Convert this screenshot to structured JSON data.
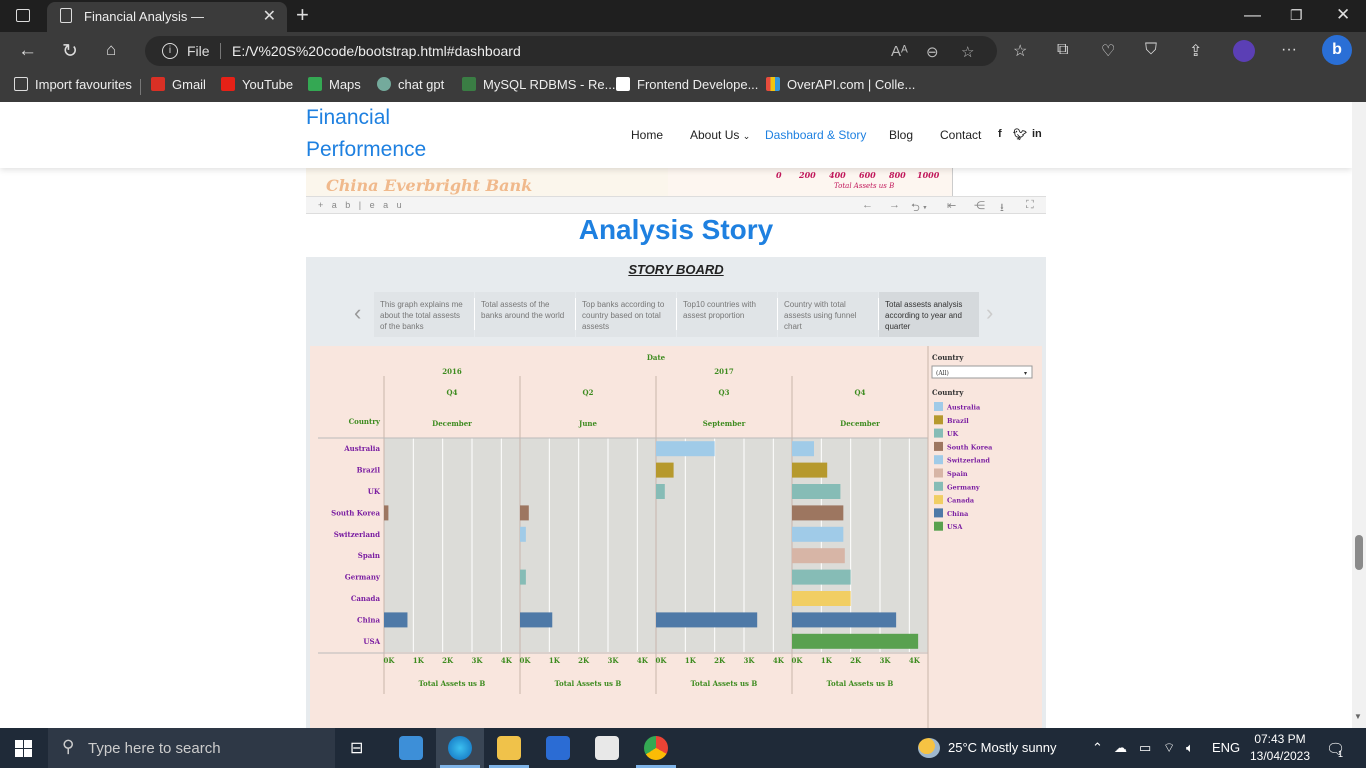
{
  "browser": {
    "tab_title": "Financial Analysis —",
    "url_scheme": "File",
    "url": "E:/V%20S%20code/bootstrap.html#dashboard",
    "bookmarks": [
      "Import favourites",
      "Gmail",
      "YouTube",
      "Maps",
      "chat gpt",
      "MySQL RDBMS - Re...",
      "Frontend Develope...",
      "OverAPI.com | Colle..."
    ]
  },
  "site": {
    "brand_line1": "Financial",
    "brand_line2": "Performence",
    "nav": [
      "Home",
      "About Us",
      "Dashboard & Story",
      "Blog",
      "Contact"
    ],
    "active_nav": "Dashboard & Story",
    "social_icons": [
      "facebook-icon",
      "twitter-icon",
      "linkedin-icon"
    ]
  },
  "previous_viz": {
    "bank_label": "China Everbright Bank",
    "axis_ticks": [
      "0",
      "200",
      "400",
      "600",
      "800",
      "1000"
    ],
    "axis_title": "Total Assets us B",
    "toolbar_logo": "+ a b | e a u"
  },
  "section_title": "Analysis Story",
  "story": {
    "title": "STORY BOARD",
    "points": [
      "This graph explains me about the total assests of the banks",
      "Total assests of the banks around the world",
      "Top banks according to country based on total assests",
      "Top10 countries with assest proportion",
      "Country with total assests using funnel chart",
      "Total assests analysis according to year and quarter"
    ],
    "active_point": 5
  },
  "chart_data": {
    "type": "bar",
    "orientation": "horizontal",
    "header_title": "Date",
    "row_header": "Country",
    "years": [
      {
        "label": "2016",
        "span": 1
      },
      {
        "label": "2017",
        "span": 3
      }
    ],
    "panels": [
      {
        "quarter": "Q4",
        "month": "December"
      },
      {
        "quarter": "Q2",
        "month": "June"
      },
      {
        "quarter": "Q3",
        "month": "September"
      },
      {
        "quarter": "Q4",
        "month": "December"
      }
    ],
    "categories": [
      "Australia",
      "Brazil",
      "UK",
      "South Korea",
      "Switzerland",
      "Spain",
      "Germany",
      "Canada",
      "China",
      "USA"
    ],
    "colors": [
      "#a0cbe8",
      "#b6992d",
      "#86bcb6",
      "#9d7660",
      "#a0cbe8",
      "#d7b5a6",
      "#86bcb6",
      "#f1ce63",
      "#4e79a7",
      "#59a14f"
    ],
    "values_by_panel": [
      [
        0,
        0,
        0,
        150,
        0,
        0,
        0,
        0,
        800,
        0
      ],
      [
        0,
        0,
        0,
        300,
        200,
        0,
        200,
        0,
        1100,
        0
      ],
      [
        2000,
        600,
        300,
        0,
        0,
        0,
        0,
        0,
        3450,
        0
      ],
      [
        750,
        1200,
        1650,
        1750,
        1750,
        1800,
        2000,
        2000,
        3550,
        4300
      ]
    ],
    "x_ticks": [
      "0K",
      "1K",
      "2K",
      "3K",
      "4K"
    ],
    "xlim": [
      0,
      4500
    ],
    "xlabel": "Total Assets us B",
    "legend": {
      "filter_title": "Country",
      "filter_value": "(All)",
      "title": "Country",
      "items": [
        "Australia",
        "Brazil",
        "UK",
        "South Korea",
        "Switzerland",
        "Spain",
        "Germany",
        "Canada",
        "China",
        "USA"
      ],
      "position": "right"
    }
  },
  "taskbar": {
    "search_placeholder": "Type here to search",
    "weather": "25°C  Mostly sunny",
    "language": "ENG",
    "time": "07:43 PM",
    "date": "13/04/2023",
    "notifications": "1"
  }
}
